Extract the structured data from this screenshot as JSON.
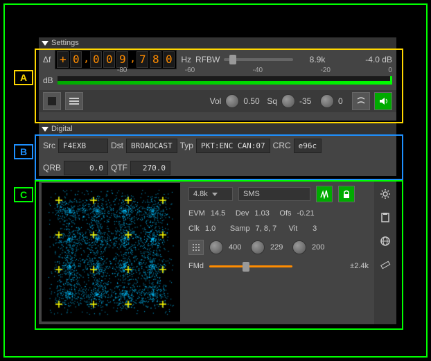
{
  "sectionA": {
    "header": "Settings",
    "deltaF_label": "Δf",
    "freq_sign": "+",
    "freq_digits": [
      "0",
      "0",
      "0",
      "9",
      "7",
      "8",
      "0"
    ],
    "freq_unit": "Hz",
    "rfbw_label": "RFBW",
    "rfbw_value": "8.9k",
    "gain_db": "-4.0 dB",
    "db_label": "dB",
    "db_ticks": [
      "-80",
      "-60",
      "-40",
      "-20",
      "0"
    ],
    "vol_label": "Vol",
    "vol_value": "0.50",
    "sq_label": "Sq",
    "sq_value": "-35",
    "sq2_value": "0"
  },
  "sectionB": {
    "header": "Digital",
    "src_label": "Src",
    "src_value": "F4EXB",
    "dst_label": "Dst",
    "dst_value": "BROADCAST",
    "typ_label": "Typ",
    "typ_value": "PKT:ENC CAN:07",
    "crc_label": "CRC",
    "crc_value": "e96c",
    "qrb_label": "QRB",
    "qrb_value": "0.0",
    "qtf_label": "QTF",
    "qtf_value": "270.0"
  },
  "sectionC": {
    "baud_value": "4.8k",
    "mode_value": "SMS",
    "evm_label": "EVM",
    "evm_value": "14.5",
    "dev_label": "Dev",
    "dev_value": "1.03",
    "ofs_label": "Ofs",
    "ofs_value": "-0.21",
    "clk_label": "Clk",
    "clk_value": "1.0",
    "samp_label": "Samp",
    "samp_value": "7, 8, 7",
    "vit_label": "Vit",
    "vit_value": "3",
    "knob1_value": "400",
    "knob2_value": "229",
    "knob3_value": "200",
    "fmd_label": "FMd",
    "fmd_value": "±2.4k"
  },
  "labels": {
    "A": "A",
    "B": "B",
    "C": "C"
  }
}
